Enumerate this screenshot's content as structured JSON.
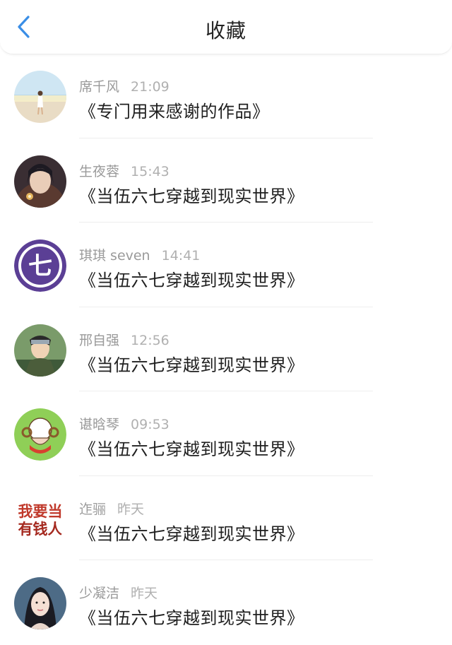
{
  "header": {
    "title": "收藏",
    "back_icon": "chevron-left-icon",
    "accent": "#3a8ee6"
  },
  "items": [
    {
      "user": "席千风",
      "time": "21:09",
      "work": "《专门用来感谢的作品》",
      "avatar": "beach-girl-avatar"
    },
    {
      "user": "生夜蓉",
      "time": "15:43",
      "work": "《当伍六七穿越到现实世界》",
      "avatar": "sparkler-boy-avatar"
    },
    {
      "user": "琪琪 seven",
      "time": "14:41",
      "work": "《当伍六七穿越到现实世界》",
      "avatar": "purple-logo-avatar"
    },
    {
      "user": "邢自强",
      "time": "12:56",
      "work": "《当伍六七穿越到现实世界》",
      "avatar": "ninja-avatar"
    },
    {
      "user": "谌晗琴",
      "time": "09:53",
      "work": "《当伍六七穿越到现实世界》",
      "avatar": "sheep-avatar"
    },
    {
      "user": "迮骊",
      "time": "昨天",
      "work": "《当伍六七穿越到现实世界》",
      "avatar": "text-avatar",
      "avatar_text": [
        "我要当",
        "有钱人"
      ]
    },
    {
      "user": "少凝洁",
      "time": "昨天",
      "work": "《当伍六七穿越到现实世界》",
      "avatar": "woman-portrait-avatar"
    }
  ]
}
